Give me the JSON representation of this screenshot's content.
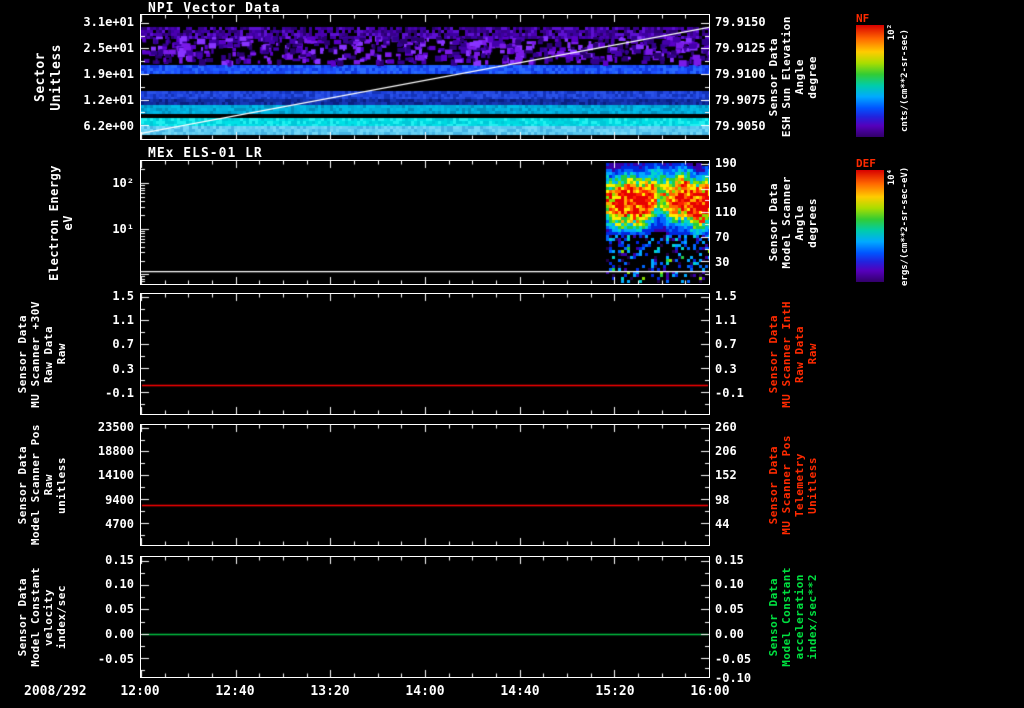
{
  "chart_data": {
    "type": "multi-panel-time-series-spectrogram",
    "x_axis": {
      "date_label": "2008/292",
      "tick_labels": [
        "12:00",
        "12:40",
        "13:20",
        "14:00",
        "14:40",
        "15:20",
        "16:00"
      ]
    },
    "panels": [
      {
        "title": "NPI Vector Data",
        "type": "band-spectrogram",
        "left_label_lines": [
          "Sector",
          "Unitless"
        ],
        "left_label_color": "#ffffff",
        "right_label_lines": [
          "Sensor Data",
          "ESH Sun Elevation",
          "Angle",
          "degree"
        ],
        "right_label_color": "#ffffff",
        "left_ticks": [
          {
            "label": "3.1e+01",
            "frac": 0.063
          },
          {
            "label": "2.5e+01",
            "frac": 0.27
          },
          {
            "label": "1.9e+01",
            "frac": 0.476
          },
          {
            "label": "1.2e+01",
            "frac": 0.682
          },
          {
            "label": "6.2e+00",
            "frac": 0.889
          }
        ],
        "right_ticks": [
          {
            "label": "79.9150",
            "frac": 0.063
          },
          {
            "label": "79.9125",
            "frac": 0.27
          },
          {
            "label": "79.9100",
            "frac": 0.476
          },
          {
            "label": "79.9075",
            "frac": 0.682
          },
          {
            "label": "79.9050",
            "frac": 0.889
          }
        ],
        "bands": [
          {
            "y0": 0.1,
            "y1": 0.17,
            "colors": [
              "#4a00b0",
              "#38008c",
              "#5c10d0",
              "#2a0070",
              "#000000",
              "#3c00a0"
            ]
          },
          {
            "y0": 0.4,
            "y1": 0.468,
            "colors": [
              "#1c50ff",
              "#2a6aff",
              "#0f38e0",
              "#2060ff",
              "#1844ee"
            ]
          },
          {
            "y0": 0.615,
            "y1": 0.675,
            "colors": [
              "#1b3fd8",
              "#2a52e8",
              "#1333b8",
              "#2448e0"
            ]
          },
          {
            "y0": 0.675,
            "y1": 0.727,
            "colors": [
              "#0e2a9e",
              "#1638b8",
              "#0a1f80",
              "#12309f"
            ]
          },
          {
            "y0": 0.727,
            "y1": 0.787,
            "colors": [
              "#00a8d8",
              "#00bce8",
              "#0090c0",
              "#00b0e0"
            ]
          },
          {
            "y0": 0.832,
            "y1": 0.896,
            "colors": [
              "#00e0e6",
              "#00c8d8",
              "#22f0f0",
              "#00d8e0"
            ]
          },
          {
            "y0": 0.896,
            "y1": 0.944,
            "colors": [
              "#58c8f0",
              "#74d8f8",
              "#46b4e4",
              "#66d0f4"
            ]
          }
        ],
        "speckle": {
          "y0": 0.17,
          "y1": 0.37,
          "count": 620,
          "colors": [
            "#5a00c8",
            "#4400aa",
            "#7a1ae8",
            "#32008c",
            "#8833ff",
            "#2a0070"
          ]
        },
        "overlay_line": {
          "x0_frac": 0,
          "y0_frac": 0.955,
          "x1_frac": 1,
          "y1_frac": 0.1,
          "color": "#ffffff"
        }
      },
      {
        "title": "MEx ELS-01 LR",
        "type": "blob-spectrogram",
        "left_label_lines": [
          "Electron Energy",
          "eV"
        ],
        "left_label_color": "#ffffff",
        "right_label_lines": [
          "Sensor Data",
          "Model Scanner",
          "Angle",
          "degrees"
        ],
        "right_label_color": "#ffffff",
        "left_ticks": [
          {
            "label": "10²",
            "frac": 0.18
          },
          {
            "label": "10¹",
            "frac": 0.55
          }
        ],
        "left_extra_major_fracs": [
          0.92
        ],
        "left_minor_fracs": [
          0.069,
          0.197,
          0.216,
          0.237,
          0.262,
          0.291,
          0.327,
          0.373,
          0.439,
          0.567,
          0.586,
          0.607,
          0.632,
          0.661,
          0.697,
          0.743,
          0.809,
          0.937,
          0.956,
          0.978
        ],
        "right_ticks": [
          {
            "label": "190",
            "frac": 0.024
          },
          {
            "label": "150",
            "frac": 0.224
          },
          {
            "label": "110",
            "frac": 0.416
          },
          {
            "label": "70",
            "frac": 0.616
          },
          {
            "label": "30",
            "frac": 0.816
          }
        ],
        "blob": {
          "x0_frac": 0.82,
          "y_center": 0.3,
          "y_sigma": 0.155,
          "speckle_top": 0.58,
          "speckle_density": 0.5
        },
        "overlay_line": {
          "x0_frac": 0,
          "y0_frac": 0.9,
          "x1_frac": 1,
          "y1_frac": 0.9,
          "color": "#ffffff"
        }
      },
      {
        "title": "",
        "type": "line",
        "left_label_lines": [
          "Sensor Data",
          "MU Scanner +30V",
          "Raw Data",
          "Raw"
        ],
        "left_label_color": "#ffffff",
        "right_label_lines": [
          "Sensor Data",
          "MU Scanner IntH",
          "Raw Data",
          "Raw"
        ],
        "right_label_color": "#ff2a00",
        "left_ticks": [
          {
            "label": "1.5",
            "frac": 0.025
          },
          {
            "label": "1.1",
            "frac": 0.22
          },
          {
            "label": "0.7",
            "frac": 0.42
          },
          {
            "label": "0.3",
            "frac": 0.62
          },
          {
            "label": "-0.1",
            "frac": 0.82
          }
        ],
        "right_ticks": [
          {
            "label": "1.5",
            "frac": 0.025
          },
          {
            "label": "1.1",
            "frac": 0.22
          },
          {
            "label": "0.7",
            "frac": 0.42
          },
          {
            "label": "0.3",
            "frac": 0.62
          },
          {
            "label": "-0.1",
            "frac": 0.82
          }
        ],
        "line": {
          "frac": 0.755,
          "color": "#ff0000",
          "approx_value": 0.0
        }
      },
      {
        "title": "",
        "type": "line",
        "left_label_lines": [
          "Sensor Data",
          "Model Scanner Pos",
          "Raw",
          "unitless"
        ],
        "left_label_color": "#ffffff",
        "right_label_lines": [
          "Sensor Data",
          "MU Scanner Pos",
          "Telemetry",
          "Unitless"
        ],
        "right_label_color": "#ff2a00",
        "left_ticks": [
          {
            "label": "23500",
            "frac": 0.025
          },
          {
            "label": "18800",
            "frac": 0.22
          },
          {
            "label": "14100",
            "frac": 0.42
          },
          {
            "label": "9400",
            "frac": 0.62
          },
          {
            "label": "4700",
            "frac": 0.82
          }
        ],
        "right_ticks": [
          {
            "label": "260",
            "frac": 0.025
          },
          {
            "label": "206",
            "frac": 0.22
          },
          {
            "label": "152",
            "frac": 0.42
          },
          {
            "label": "98",
            "frac": 0.62
          },
          {
            "label": "44",
            "frac": 0.82
          }
        ],
        "line": {
          "frac": 0.67,
          "color": "#ff0000",
          "approx_value": 8200
        }
      },
      {
        "title": "",
        "type": "line",
        "left_label_lines": [
          "Sensor Data",
          "Model Constant",
          "velocity",
          "index/sec"
        ],
        "left_label_color": "#ffffff",
        "right_label_lines": [
          "Sensor Data",
          "Model Constant",
          "acceleration",
          "index/sec**2"
        ],
        "right_label_color": "#00e040",
        "left_ticks": [
          {
            "label": "0.15",
            "frac": 0.03
          },
          {
            "label": "0.10",
            "frac": 0.23
          },
          {
            "label": "0.05",
            "frac": 0.435
          },
          {
            "label": "0.00",
            "frac": 0.64
          },
          {
            "label": "-0.05",
            "frac": 0.845
          }
        ],
        "right_ticks": [
          {
            "label": "0.15",
            "frac": 0.03
          },
          {
            "label": "0.10",
            "frac": 0.23
          },
          {
            "label": "0.05",
            "frac": 0.435
          },
          {
            "label": "0.00",
            "frac": 0.64
          },
          {
            "label": "-0.05",
            "frac": 0.845
          },
          {
            "label": "-0.10",
            "frac": 1.0
          }
        ],
        "line": {
          "frac": 0.64,
          "color": "#00c040",
          "approx_value": 0.0
        }
      }
    ],
    "colorbars": [
      {
        "title": "NF",
        "title_color": "#ff2a00",
        "top_tick": "10²",
        "units": "cnts/(cm**2-sr-sec)"
      },
      {
        "title": "DEF",
        "title_color": "#ff2a00",
        "top_tick": "10⁴",
        "units": "ergs/(cm**2-sr-sec-eV)"
      }
    ]
  }
}
